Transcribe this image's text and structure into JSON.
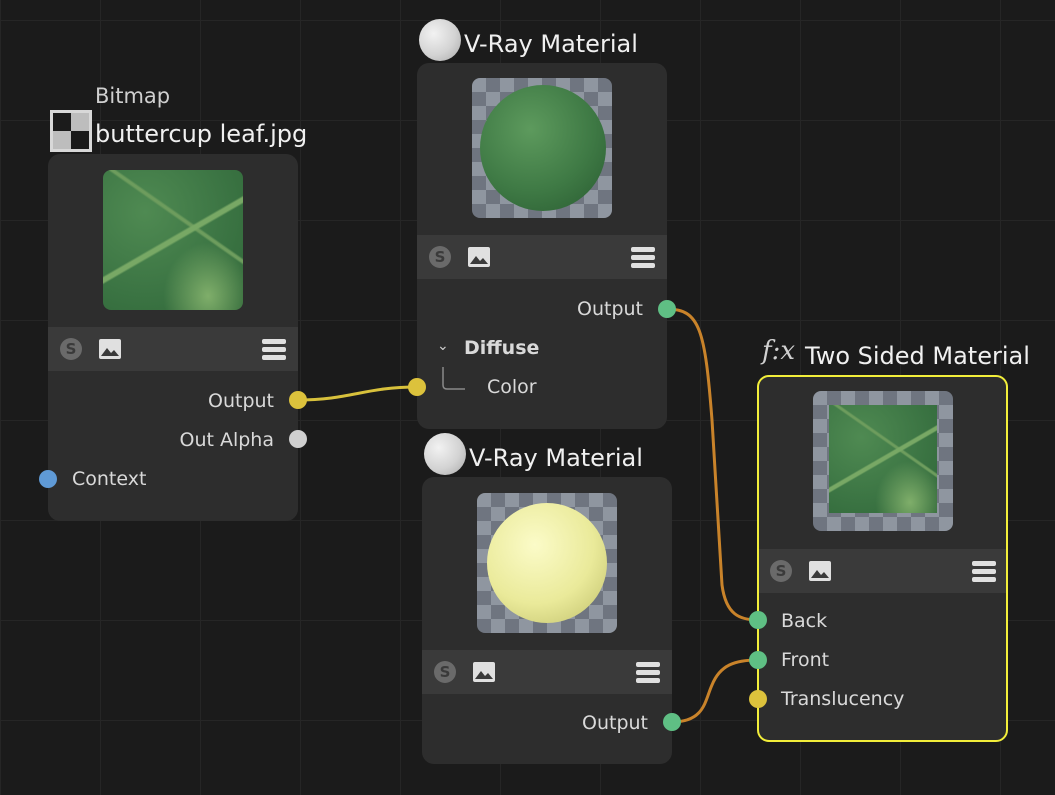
{
  "bitmap_node": {
    "type_label": "Bitmap",
    "title": "buttercup leaf.jpg",
    "ports": {
      "output": "Output",
      "out_alpha": "Out Alpha",
      "context": "Context"
    }
  },
  "vray_material_1": {
    "title": "V-Ray Material",
    "ports": {
      "output": "Output"
    },
    "section": "Diffuse",
    "section_port": "Color"
  },
  "vray_material_2": {
    "title": "V-Ray Material",
    "ports": {
      "output": "Output"
    }
  },
  "two_sided_material": {
    "fx_label": "f:x",
    "title": "Two Sided Material",
    "ports": {
      "back": "Back",
      "front": "Front",
      "translucency": "Translucency"
    }
  },
  "colors": {
    "green_port": "#5fbf84",
    "yellow_port": "#dcc23c",
    "grey_port": "#cfcfcf",
    "blue_port": "#5f9ad6",
    "selection": "#f2ee3a",
    "wire_orange": "#c9832a",
    "wire_yellow": "#d8c13c"
  },
  "icons": [
    "shader-s-icon",
    "image-icon",
    "menu-icon",
    "checker-icon",
    "sphere-icon",
    "chevron-down-icon"
  ]
}
